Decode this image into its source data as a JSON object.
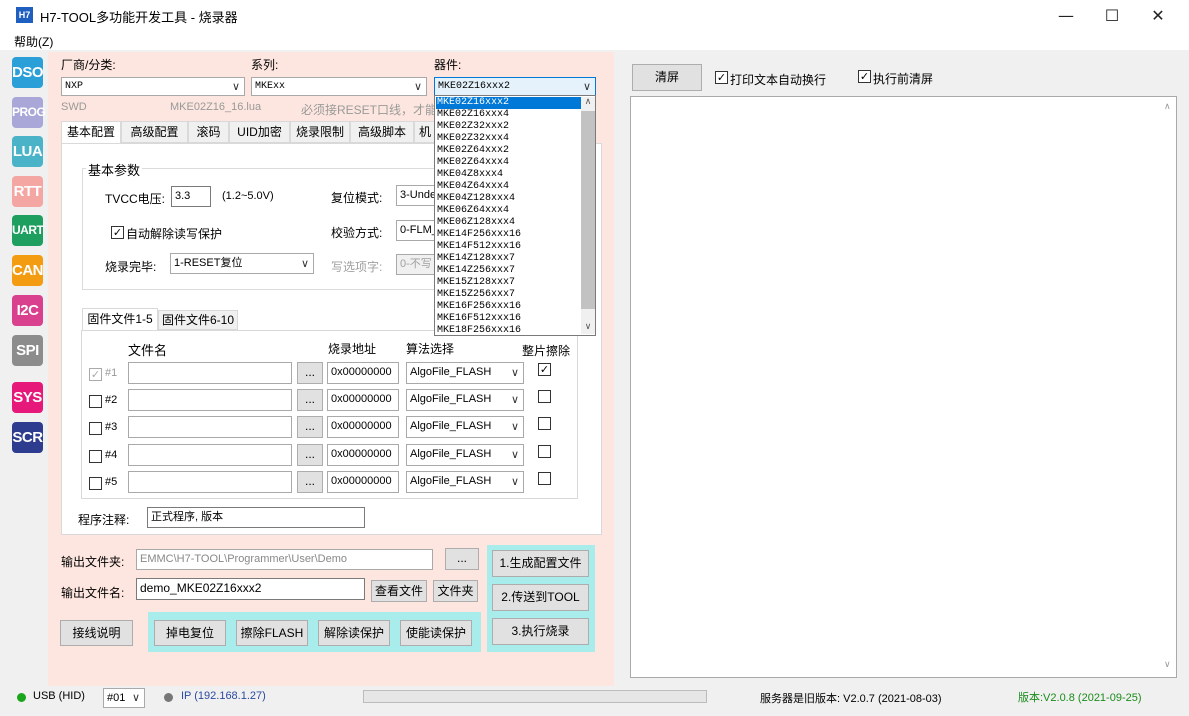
{
  "window": {
    "title": "H7-TOOL多功能开发工具 - 烧录器",
    "icon_text": "H7"
  },
  "menu": {
    "help": "帮助(Z)"
  },
  "modules": [
    {
      "label": "DSO",
      "color": "#2a9fd8"
    },
    {
      "label": "PROG",
      "color": "#a9a7d8"
    },
    {
      "label": "LUA",
      "color": "#4ab3c8"
    },
    {
      "label": "RTT",
      "color": "#f3a6a2"
    },
    {
      "label": "UART",
      "color": "#1f9f5f"
    },
    {
      "label": "CAN",
      "color": "#f39c12"
    },
    {
      "label": "I2C",
      "color": "#d9418e"
    },
    {
      "label": "SPI",
      "color": "#8c8c8c"
    },
    {
      "label": "SYS",
      "color": "#e6197a"
    },
    {
      "label": "SCR",
      "color": "#2d3c8f"
    }
  ],
  "selectors": {
    "vendor_label": "厂商/分类:",
    "vendor_value": "NXP",
    "series_label": "系列:",
    "series_value": "MKExx",
    "device_label": "器件:",
    "device_value": "MKE02Z16xxx2"
  },
  "info": {
    "interface": "SWD",
    "lua_file": "MKE02Z16_16.lua",
    "note": "必须接RESET口线，才能解"
  },
  "tabs": [
    "基本配置",
    "高级配置",
    "滚码",
    "UID加密",
    "烧录限制",
    "高级脚本",
    "机"
  ],
  "basic": {
    "group_title": "基本参数",
    "tvcc_label": "TVCC电压:",
    "tvcc_value": "3.3",
    "tvcc_range": "(1.2~5.0V)",
    "reset_mode_label": "复位模式:",
    "reset_mode_value": "3-Unde",
    "auto_unlock_label": "自动解除读写保护",
    "verify_label": "校验方式:",
    "verify_value": "0-FLM_",
    "finish_label": "烧录完毕:",
    "finish_value": "1-RESET复位",
    "option_label": "写选项字:",
    "option_value": "0-不写"
  },
  "firmware": {
    "tabs": [
      "固件文件1-5",
      "固件文件6-10"
    ],
    "headers": {
      "file": "文件名",
      "address": "烧录地址",
      "algo": "算法选择",
      "erase": "整片擦除"
    },
    "rows": [
      {
        "num": "#1",
        "file": "",
        "address": "0x00000000",
        "algo": "AlgoFile_FLASH",
        "enabled": true,
        "erase": true
      },
      {
        "num": "#2",
        "file": "",
        "address": "0x00000000",
        "algo": "AlgoFile_FLASH",
        "enabled": false,
        "erase": false
      },
      {
        "num": "#3",
        "file": "",
        "address": "0x00000000",
        "algo": "AlgoFile_FLASH",
        "enabled": false,
        "erase": false
      },
      {
        "num": "#4",
        "file": "",
        "address": "0x00000000",
        "algo": "AlgoFile_FLASH",
        "enabled": false,
        "erase": false
      },
      {
        "num": "#5",
        "file": "",
        "address": "0x00000000",
        "algo": "AlgoFile_FLASH",
        "enabled": false,
        "erase": false
      }
    ],
    "browse": "..."
  },
  "comment": {
    "label": "程序注释:",
    "value": "正式程序, 版本"
  },
  "output": {
    "folder_label": "输出文件夹:",
    "folder_value": "EMMC\\H7-TOOL\\Programmer\\User\\Demo",
    "folder_browse": "...",
    "name_label": "输出文件名:",
    "name_value": "demo_MKE02Z16xxx2",
    "view_file": "查看文件",
    "folder_btn": "文件夹"
  },
  "actions": {
    "generate": "1.生成配置文件",
    "send": "2.传送到TOOL",
    "execute": "3.执行烧录",
    "wiring": "接线说明",
    "power_reset": "掉电复位",
    "erase_flash": "擦除FLASH",
    "unlock": "解除读保护",
    "lock": "使能读保护"
  },
  "device_list": [
    "MKE02Z16xxx2",
    "MKE02Z16xxx4",
    "MKE02Z32xxx2",
    "MKE02Z32xxx4",
    "MKE02Z64xxx2",
    "MKE02Z64xxx4",
    "MKE04Z8xxx4",
    "MKE04Z64xxx4",
    "MKE04Z128xxx4",
    "MKE06Z64xxx4",
    "MKE06Z128xxx4",
    "MKE14F256xxx16",
    "MKE14F512xxx16",
    "MKE14Z128xxx7",
    "MKE14Z256xxx7",
    "MKE15Z128xxx7",
    "MKE15Z256xxx7",
    "MKE16F256xxx16",
    "MKE16F512xxx16",
    "MKE18F256xxx16"
  ],
  "log": {
    "clear": "清屏",
    "wrap_label": "打印文本自动换行",
    "clear_before_label": "执行前清屏",
    "wrap": true,
    "clear_before": true
  },
  "status": {
    "usb": "USB (HID)",
    "usb_color": "#1aa51a",
    "port": "#01",
    "ip": "IP (192.168.1.27)",
    "ip_color": "#777777",
    "server": "服务器是旧版本: V2.0.7 (2021-08-03)",
    "version": "版本:V2.0.8 (2021-09-25)",
    "version_color": "#1a8c1a"
  }
}
